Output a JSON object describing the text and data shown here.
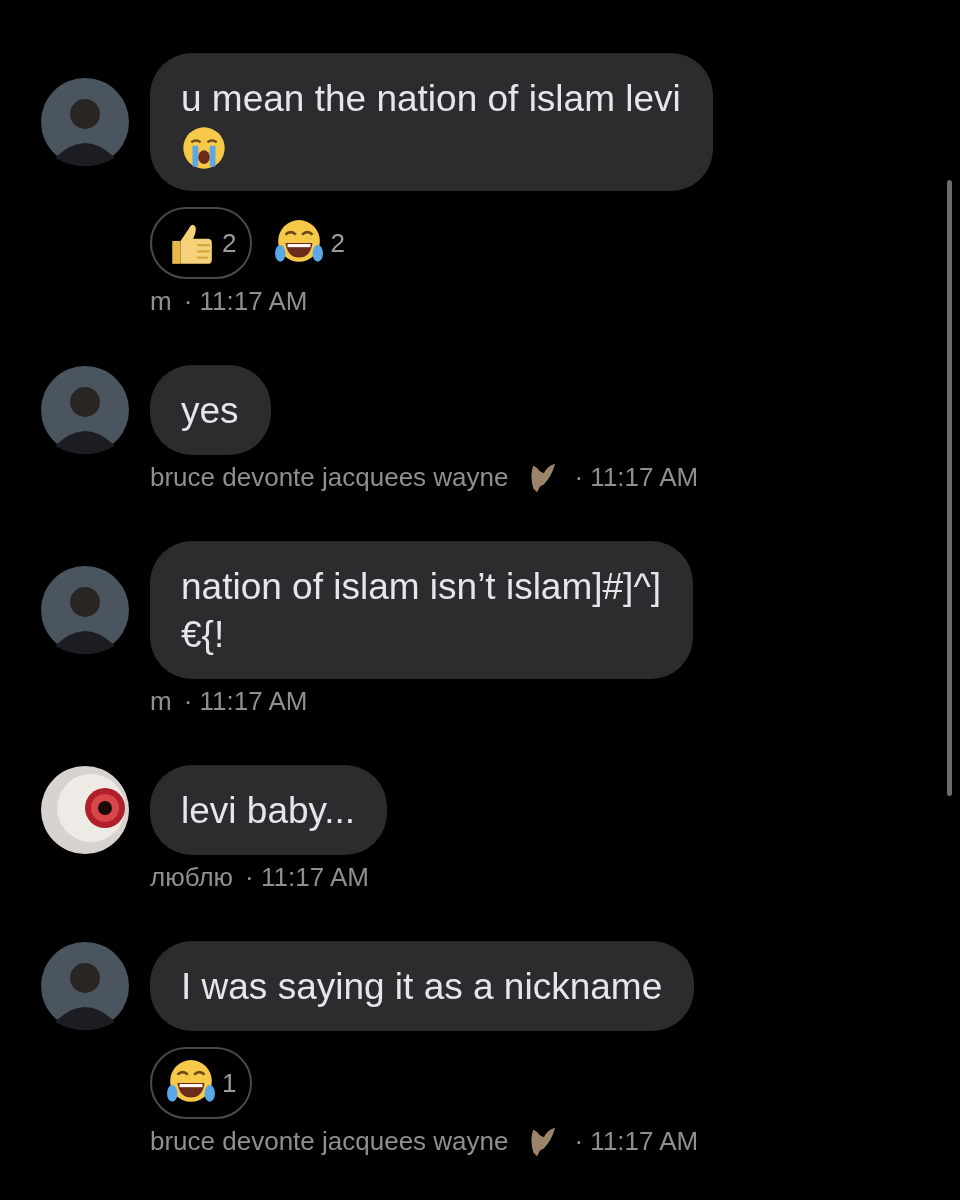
{
  "messages": [
    {
      "avatar": {
        "kind": "person"
      },
      "text": "u mean the nation of islam levi",
      "trailing_emoji": true,
      "reactions": [
        {
          "kind": "thumbs_up",
          "count": "2",
          "selected": true
        },
        {
          "kind": "laughing",
          "count": "2",
          "selected": false
        }
      ],
      "sender": "m",
      "time": "· 11:17 AM"
    },
    {
      "avatar": {
        "kind": "person"
      },
      "text": "yes",
      "trailing_emoji": false,
      "sender": "bruce devonte jacquees wayne",
      "sender_badge": {
        "kind": "bat"
      },
      "time": "· 11:17 AM"
    },
    {
      "avatar": {
        "kind": "person"
      },
      "text": "nation of islam isn’t islam]#]^]\n€{!",
      "trailing_emoji": false,
      "sender": "m",
      "time": "· 11:17 AM"
    },
    {
      "avatar": {
        "kind": "eye"
      },
      "text": "levi baby...",
      "trailing_emoji": false,
      "sender": "люблю",
      "time": "· 11:17 AM"
    },
    {
      "avatar": {
        "kind": "person"
      },
      "text": "I was saying it as a nickname",
      "trailing_emoji": false,
      "reactions": [
        {
          "kind": "laughing",
          "count": "1",
          "selected": true
        }
      ],
      "sender": "bruce devonte jacquees wayne",
      "sender_badge": {
        "kind": "bat"
      },
      "time": "· 11:17 AM"
    }
  ]
}
